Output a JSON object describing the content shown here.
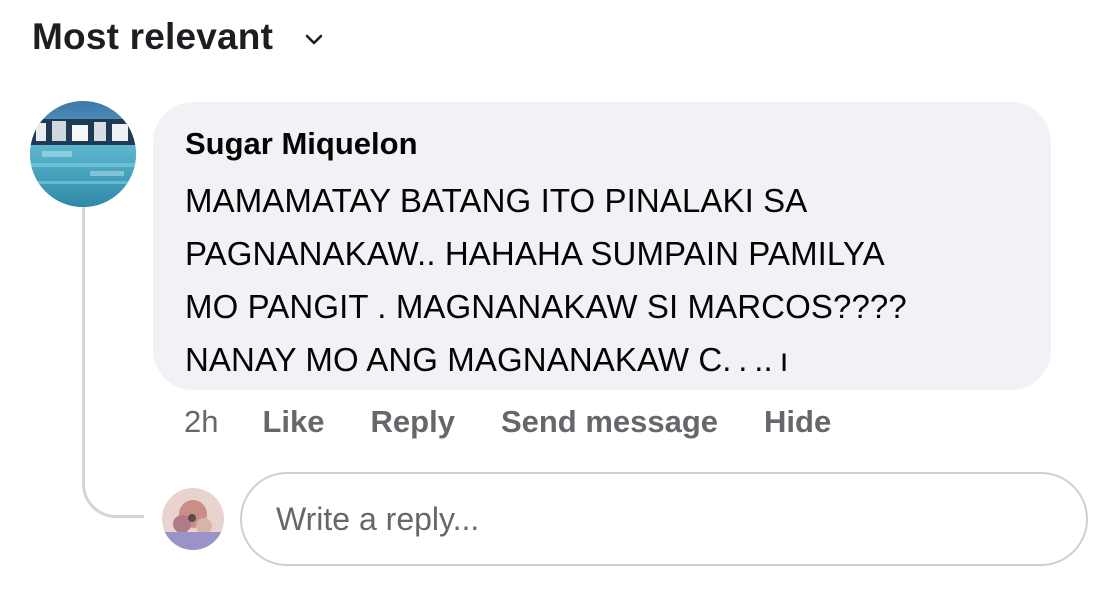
{
  "sort": {
    "label": "Most relevant",
    "icon": "chevron-down-icon"
  },
  "comment": {
    "author": "Sugar Miquelon",
    "text": "MAMAMATAY BATANG ITO PINALAKI SA\nPAGNANAKAW.. HAHAHA SUMPAIN PAMILYA\nMO PANGIT .  MAGNANAKAW SI MARCOS????\nNANAY MO ANG MAGNANAKAW C. . .. ı",
    "time": "2h",
    "actions": {
      "like": "Like",
      "reply": "Reply",
      "send_message": "Send message",
      "hide": "Hide"
    }
  },
  "reply": {
    "placeholder": "Write a reply..."
  },
  "colors": {
    "bubble": "#f0f2f5",
    "secondary_text": "#65676b",
    "primary_text": "#050505",
    "thread_line": "#d2d5da"
  }
}
